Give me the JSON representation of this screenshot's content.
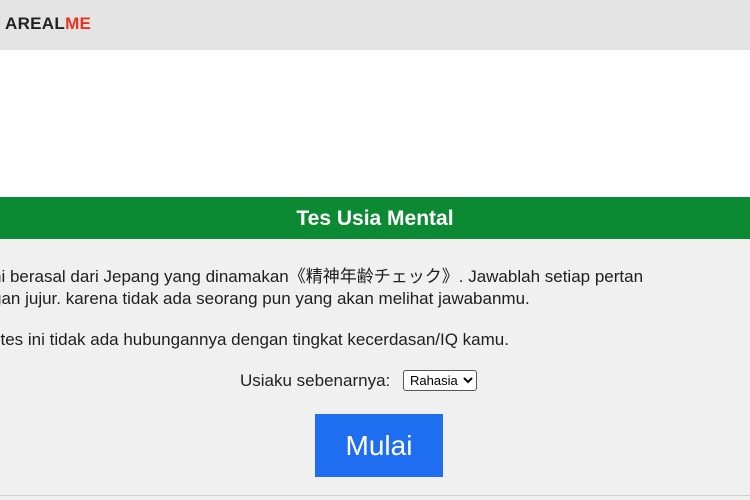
{
  "header": {
    "logo_part1": "AREAL",
    "logo_part2": "ME"
  },
  "colors": {
    "title_bar": "#0b8a33",
    "start_button": "#1f6ef0",
    "logo_accent": "#e8341c"
  },
  "quiz": {
    "title": "Tes Usia Mental",
    "intro_line1": "ni berasal dari Jepang yang dinamakan《精神年齢チェック》. Jawablah setiap pertan",
    "intro_line2": "gan jujur. karena tidak ada seorang pun yang akan melihat jawabanmu.",
    "note": "l tes ini tidak ada hubungannya dengan tingkat kecerdasan/IQ kamu.",
    "age_label": "Usiaku sebenarnya:",
    "age_selected": "Rahasia",
    "start_label": "Mulai"
  }
}
